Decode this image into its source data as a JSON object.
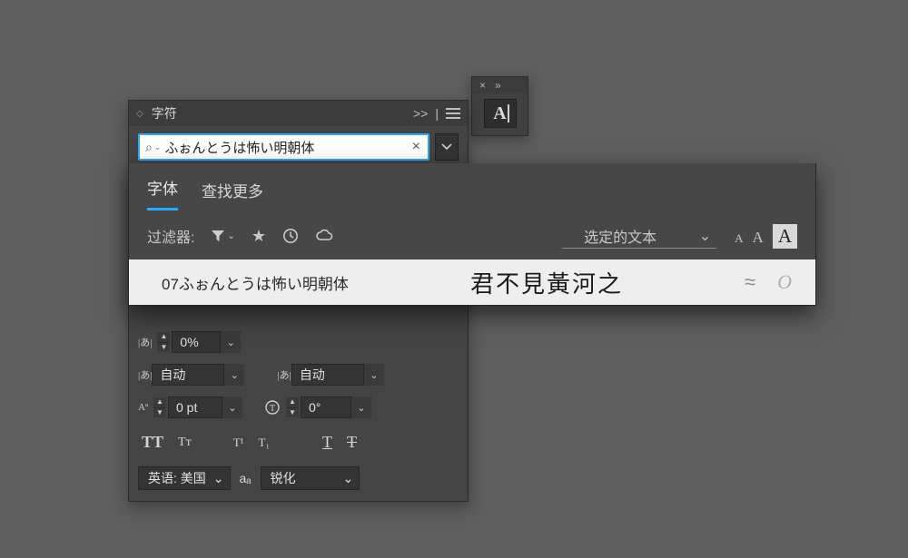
{
  "mini_panel": {
    "close_glyph": "×",
    "collapse_glyph": "»",
    "tool_letter": "A"
  },
  "panel": {
    "title": "字符",
    "collapse_glyph": ">>",
    "divider_glyph": "|",
    "font_search_value": "ふぉんとうは怖い明朝体",
    "font_dropdown_open": true
  },
  "lower_controls": {
    "tsume": {
      "icon": "|あ|",
      "value": "0%"
    },
    "kerning": {
      "icon": "|あ|",
      "value": "自动",
      "hint": "←→"
    },
    "tracking": {
      "icon": "|あ|",
      "value": "自动",
      "hint": "←→"
    },
    "baseline": {
      "icon": "Aª",
      "value": "0 pt",
      "hint": "↕"
    },
    "rotation": {
      "icon": "T",
      "value": "0°"
    }
  },
  "type_styles": {
    "all_caps": "TT",
    "small_caps": "Tᴛ",
    "superscript": "T¹",
    "subscript": "T₁",
    "underline": "T",
    "strike": "T"
  },
  "bottom": {
    "language": "英语: 美国",
    "aa_label": "aₐ",
    "aa_value": "锐化"
  },
  "flyout": {
    "tabs": {
      "fonts": "字体",
      "find_more": "查找更多"
    },
    "filter_label": "过滤器:",
    "preview_mode": "选定的文本",
    "size_letters": [
      "A",
      "A",
      "A"
    ],
    "items": [
      {
        "name": "07ふぉんとうは怖い明朝体",
        "preview": "君不見黃河之",
        "approx": "≈",
        "format": "O"
      }
    ]
  }
}
